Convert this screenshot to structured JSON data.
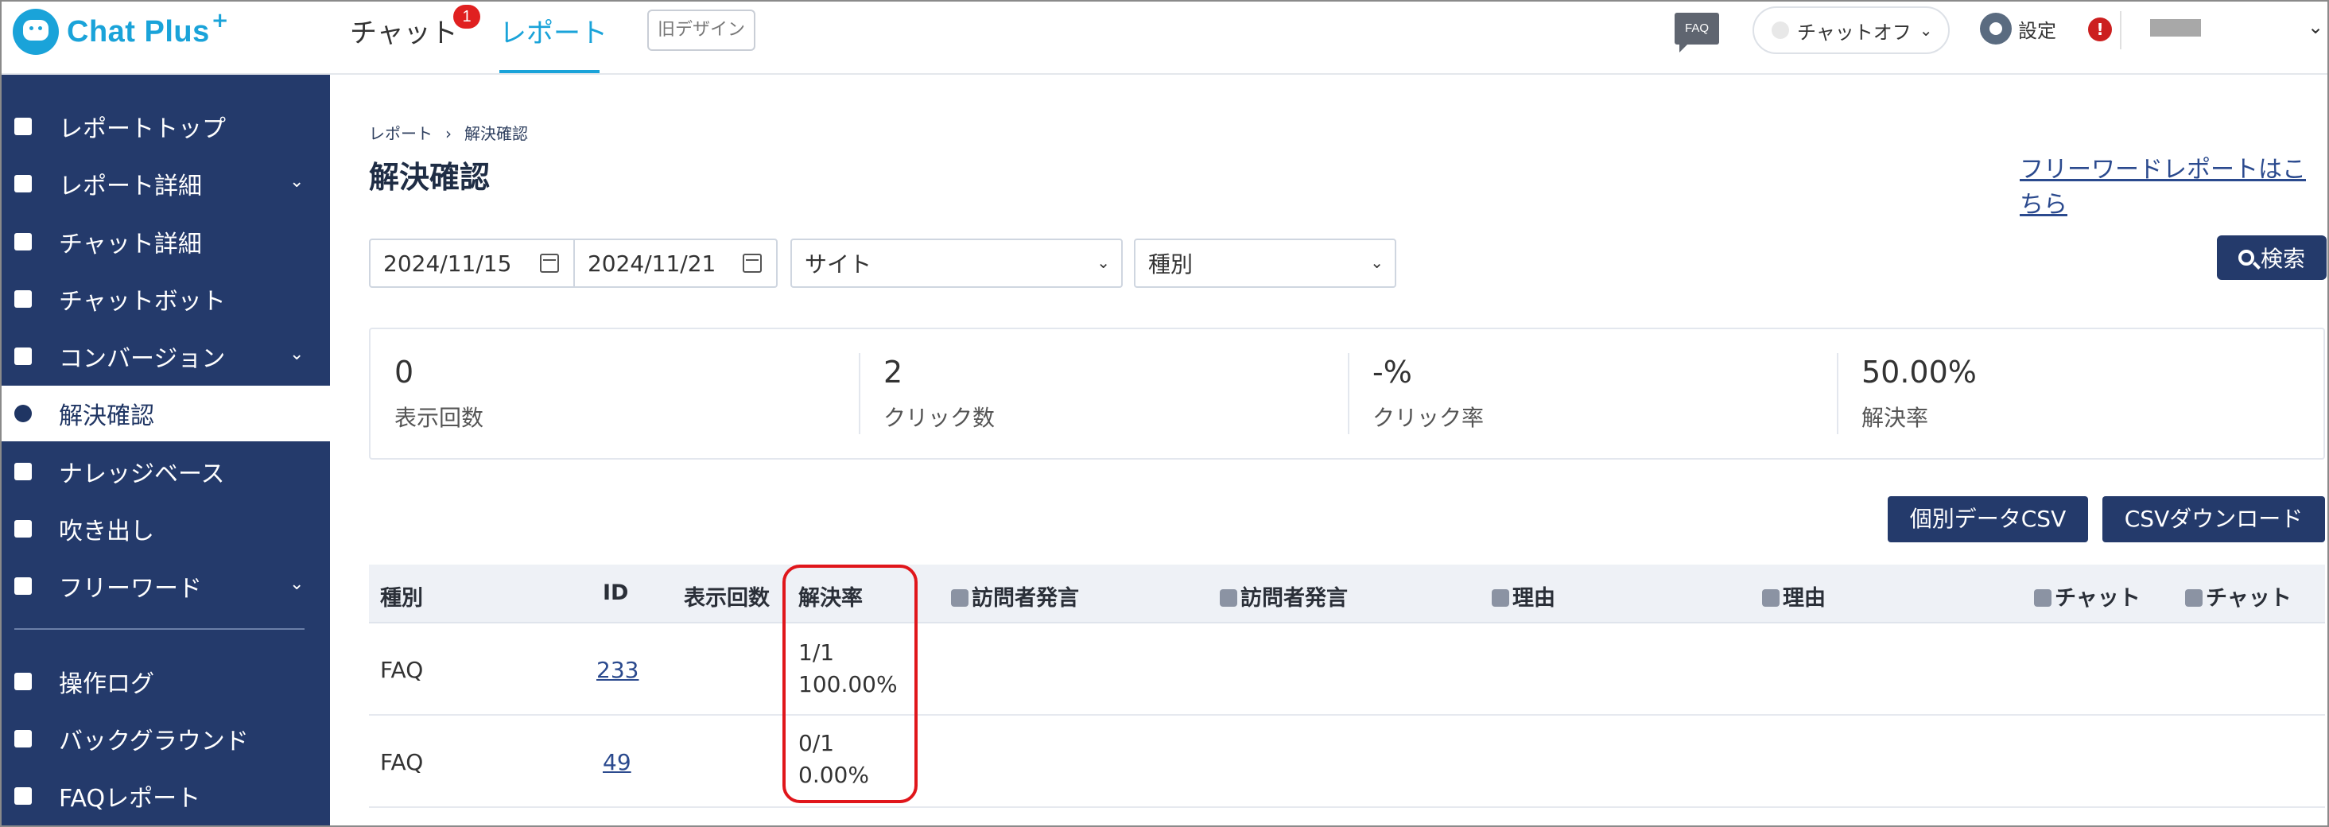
{
  "header": {
    "logo_text": "Chat Plus",
    "logo_plus": "+",
    "tabs": [
      {
        "label": "チャット"
      },
      {
        "label": "レポート"
      }
    ],
    "chat_badge": "1",
    "old_design_label": "旧デザイン",
    "faq_icon_label": "FAQ",
    "chat_status_label": "チャットオフ",
    "settings_label": "設定",
    "alert_symbol": "!"
  },
  "sidebar": {
    "items": [
      {
        "label": "レポートトップ",
        "icon": "dashboard-icon"
      },
      {
        "label": "レポート詳細",
        "icon": "chart-icon",
        "expandable": true
      },
      {
        "label": "チャット詳細",
        "icon": "chat-bubbles-icon"
      },
      {
        "label": "チャットボット",
        "icon": "bot-icon"
      },
      {
        "label": "コンバージョン",
        "icon": "star-icon",
        "expandable": true
      },
      {
        "label": "解決確認",
        "icon": "lightbulb-icon",
        "active": true
      },
      {
        "label": "ナレッジベース",
        "icon": "book-icon"
      },
      {
        "label": "吹き出し",
        "icon": "speech-bubble-icon"
      },
      {
        "label": "フリーワード",
        "icon": "abc-icon",
        "expandable": true
      },
      {
        "label": "操作ログ",
        "icon": "list-icon"
      },
      {
        "label": "バックグラウンド",
        "icon": "background-icon"
      },
      {
        "label": "FAQレポート",
        "icon": "faq-report-icon"
      }
    ]
  },
  "main": {
    "breadcrumb": [
      "レポート",
      "解決確認"
    ],
    "breadcrumb_sep": "›",
    "title": "解決確認",
    "free_word_link": "フリーワードレポートはこちら",
    "filters": {
      "date_from": "2024/11/15",
      "date_to": "2024/11/21",
      "site": "サイト",
      "kind": "種別"
    },
    "search_label": "検索",
    "stats": [
      {
        "value": "0",
        "label": "表示回数"
      },
      {
        "value": "2",
        "label": "クリック数"
      },
      {
        "value": "-%",
        "label": "クリック率"
      },
      {
        "value": "50.00%",
        "label": "解決率"
      }
    ],
    "buttons": {
      "csv_individual": "個別データCSV",
      "csv_download": "CSVダウンロード"
    },
    "table": {
      "headers": [
        "種別",
        "ID",
        "表示回数",
        "解決率",
        "訪問者発言",
        "訪問者発言",
        "理由",
        "理由",
        "チャット",
        "チャット"
      ],
      "rows": [
        {
          "kind": "FAQ",
          "id": "233",
          "views": "",
          "rate_frac": "1/1",
          "rate_pct": "100.00%"
        },
        {
          "kind": "FAQ",
          "id": "49",
          "views": "",
          "rate_frac": "0/1",
          "rate_pct": "0.00%"
        }
      ]
    }
  },
  "colors": {
    "brand": "#1aa3d9",
    "sidebar": "#243a6b",
    "badge": "#e02020",
    "highlight": "#e0161b"
  }
}
